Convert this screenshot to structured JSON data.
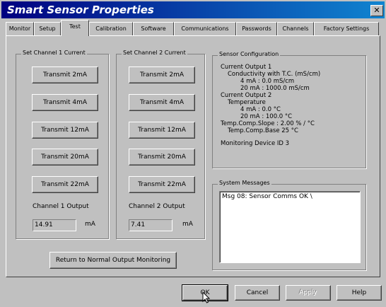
{
  "window": {
    "title": "Smart Sensor Properties",
    "close_glyph": "✕"
  },
  "tabs": [
    "Monitor",
    "Setup",
    "Test",
    "Calibration",
    "Software",
    "Communications",
    "Passwords",
    "Channels",
    "Factory Settings"
  ],
  "active_tab": "Test",
  "channel1": {
    "group_title": "Set Channel 1 Current",
    "buttons": [
      "Transmit 2mA",
      "Transmit 4mA",
      "Transmit 12mA",
      "Transmit 20mA",
      "Transmit 22mA"
    ],
    "output_label": "Channel 1 Output",
    "output_value": "14.91",
    "unit": "mA"
  },
  "channel2": {
    "group_title": "Set Channel 2 Current",
    "buttons": [
      "Transmit 2mA",
      "Transmit 4mA",
      "Transmit 12mA",
      "Transmit 20mA",
      "Transmit 22mA"
    ],
    "output_label": "Channel 2 Output",
    "output_value": "7.41",
    "unit": "mA"
  },
  "sensor_config": {
    "group_title": "Sensor Configuration",
    "lines": [
      "Current Output 1",
      "Conductivity with T.C. (mS/cm)",
      "4 mA : 0.0 mS/cm",
      "20 mA : 1000.0 mS/cm",
      "Current Output 2",
      "Temperature",
      "4 mA : 0.0 °C",
      "20 mA : 100.0 °C",
      "Temp.Comp.Slope : 2.00 % / °C",
      "Temp.Comp.Base 25 °C",
      "Monitoring Device ID 3"
    ]
  },
  "system_messages": {
    "group_title": "System Messages",
    "text": "Msg 08: Sensor Comms OK    \\"
  },
  "return_button": "Return to Normal Output Monitoring",
  "footer": {
    "ok": "OK",
    "cancel": "Cancel",
    "apply": "Apply",
    "help": "Help"
  },
  "icons": {
    "close": "close-icon",
    "cursor": "mouse-cursor-icon"
  }
}
